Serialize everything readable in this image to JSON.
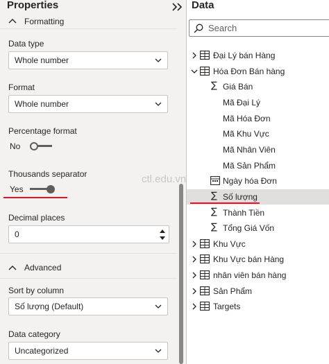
{
  "properties": {
    "title": "Properties",
    "formatting_label": "Formatting",
    "data_type": {
      "label": "Data type",
      "value": "Whole number"
    },
    "format": {
      "label": "Format",
      "value": "Whole number"
    },
    "percentage_format": {
      "label": "Percentage format",
      "state": "No"
    },
    "thousands_separator": {
      "label": "Thousands separator",
      "state": "Yes"
    },
    "decimal_places": {
      "label": "Decimal places",
      "value": "0"
    },
    "advanced_label": "Advanced",
    "sort_by_column": {
      "label": "Sort by column",
      "value": "Số lượng (Default)"
    },
    "data_category": {
      "label": "Data category",
      "value": "Uncategorized"
    }
  },
  "watermark": "ctl.edu.vn",
  "data_pane": {
    "title": "Data",
    "search_placeholder": "Search",
    "tree": [
      {
        "label": "Đại Lý bán Hàng",
        "kind": "table",
        "expanded": false
      },
      {
        "label": "Hóa Đơn Bán hàng",
        "kind": "table",
        "expanded": true
      },
      {
        "label": "Giá Bán",
        "kind": "measure"
      },
      {
        "label": "Mã Đại Lý",
        "kind": "field"
      },
      {
        "label": "Mã Hóa Đơn",
        "kind": "field"
      },
      {
        "label": "Mã Khu Vực",
        "kind": "field"
      },
      {
        "label": "Mã Nhân Viên",
        "kind": "field"
      },
      {
        "label": "Mã Sản Phẩm",
        "kind": "field"
      },
      {
        "label": "Ngày hóa Đơn",
        "kind": "date"
      },
      {
        "label": "Số lượng",
        "kind": "measure",
        "selected": true
      },
      {
        "label": "Thành Tiền",
        "kind": "measure"
      },
      {
        "label": "Tổng Giá Vốn",
        "kind": "measure"
      },
      {
        "label": "Khu Vực",
        "kind": "table",
        "expanded": false
      },
      {
        "label": "Khu Vực bán Hàng",
        "kind": "table",
        "expanded": false
      },
      {
        "label": "nhân viên bán hàng",
        "kind": "table",
        "expanded": false
      },
      {
        "label": "Sản Phẩm",
        "kind": "table",
        "expanded": false
      },
      {
        "label": "Targets",
        "kind": "table",
        "expanded": false
      }
    ]
  },
  "colors": {
    "pane_bg": "#f3f2f1",
    "selected_row": "#e1dfdd",
    "highlight_underline": "#e81123",
    "toggle": "#605e5c"
  }
}
